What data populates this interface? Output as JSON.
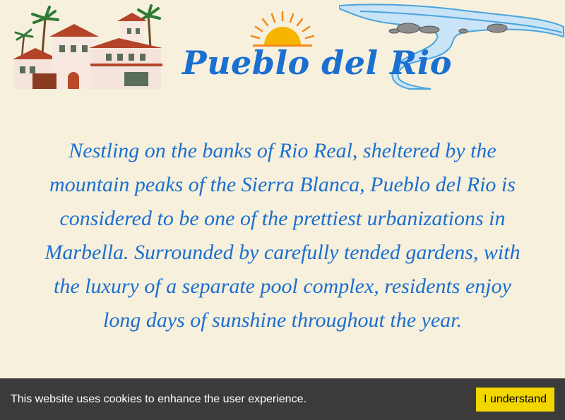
{
  "brand": {
    "title": "Pueblo del Rio",
    "color": "#1b6fd0"
  },
  "header": {
    "villa_icon": "villa-illustration",
    "sun_icon": "sunrise-icon",
    "river_icon": "river-illustration"
  },
  "intro": {
    "text": "Nestling on the banks of Rio Real, sheltered by the mountain peaks of the Sierra Blanca, Pueblo del Rio is considered to be one of the prettiest urbanizations in Marbella. Surrounded by carefully tended gardens, with the luxury of a separate pool complex, residents enjoy long days of sunshine throughout the year."
  },
  "cookie": {
    "message": "This website uses cookies to enhance the user experience.",
    "button_label": "I understand",
    "button_color": "#f1d600",
    "bar_color": "#3b3b3b"
  },
  "page": {
    "background": "#f6f0dc"
  }
}
